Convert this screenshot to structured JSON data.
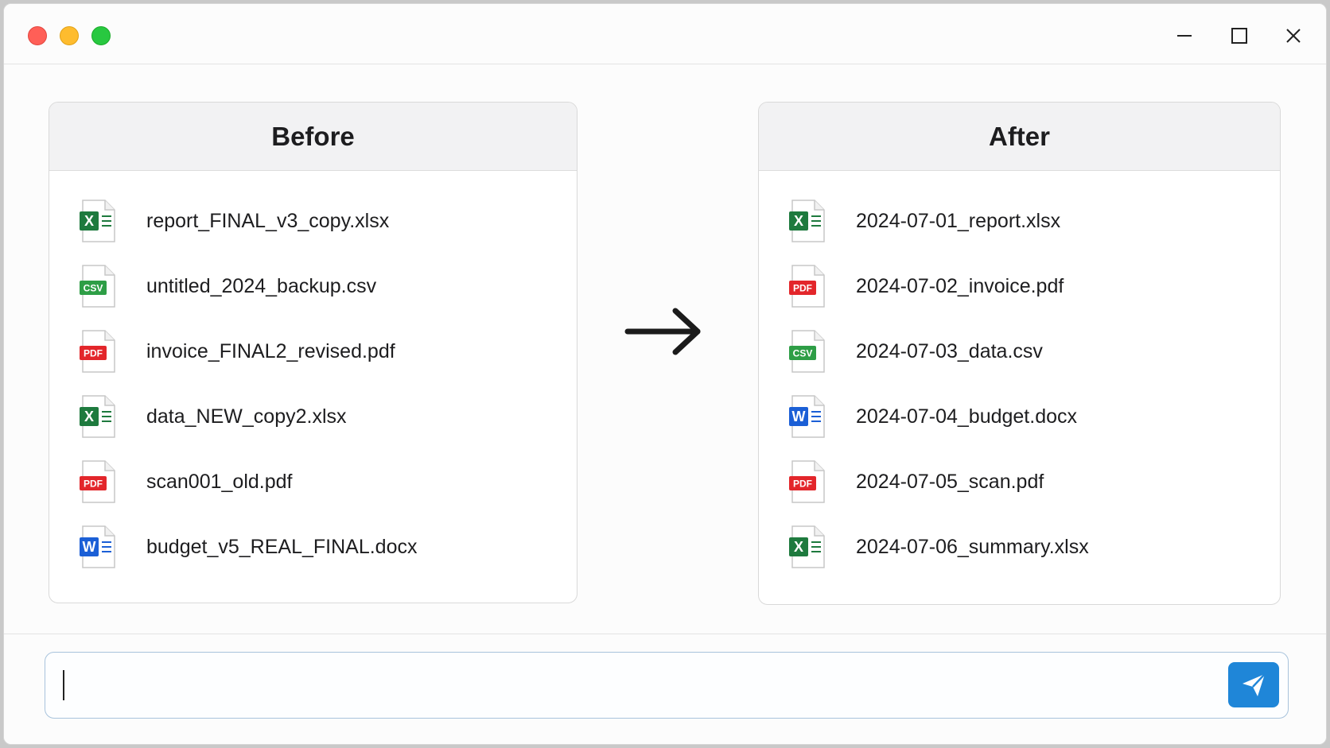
{
  "window": {
    "controls": [
      "minimize-icon",
      "maximize-icon",
      "close-icon"
    ]
  },
  "before": {
    "title": "Before",
    "files": [
      {
        "name": "report_FINAL_v3_copy.xlsx",
        "type": "xlsx",
        "icon": "excel-file-icon"
      },
      {
        "name": "untitled_2024_backup.csv",
        "type": "csv",
        "icon": "csv-file-icon"
      },
      {
        "name": "invoice_FINAL2_revised.pdf",
        "type": "pdf",
        "icon": "pdf-file-icon"
      },
      {
        "name": "data_NEW_copy2.xlsx",
        "type": "xlsx",
        "icon": "excel-file-icon"
      },
      {
        "name": "scan001_old.pdf",
        "type": "pdf",
        "icon": "pdf-file-icon"
      },
      {
        "name": "budget_v5_REAL_FINAL.docx",
        "type": "docx",
        "icon": "word-file-icon"
      }
    ]
  },
  "after": {
    "title": "After",
    "files": [
      {
        "name": "2024-07-01_report.xlsx",
        "type": "xlsx",
        "icon": "excel-file-icon"
      },
      {
        "name": "2024-07-02_invoice.pdf",
        "type": "pdf",
        "icon": "pdf-file-icon"
      },
      {
        "name": "2024-07-03_data.csv",
        "type": "csv",
        "icon": "csv-file-icon"
      },
      {
        "name": "2024-07-04_budget.docx",
        "type": "docx",
        "icon": "word-file-icon"
      },
      {
        "name": "2024-07-05_scan.pdf",
        "type": "pdf",
        "icon": "pdf-file-icon"
      },
      {
        "name": "2024-07-06_summary.xlsx",
        "type": "xlsx",
        "icon": "excel-file-icon"
      }
    ]
  },
  "icon_labels": {
    "xlsx": "X",
    "csv": "CSV",
    "pdf": "PDF",
    "docx": "W"
  },
  "colors": {
    "xlsx": "#1e7a3e",
    "csv": "#2e9e46",
    "pdf": "#e3262b",
    "docx": "#1b5fd6",
    "send": "#1f86d8"
  },
  "chat": {
    "value": "",
    "placeholder": "",
    "send_icon": "send-icon"
  }
}
